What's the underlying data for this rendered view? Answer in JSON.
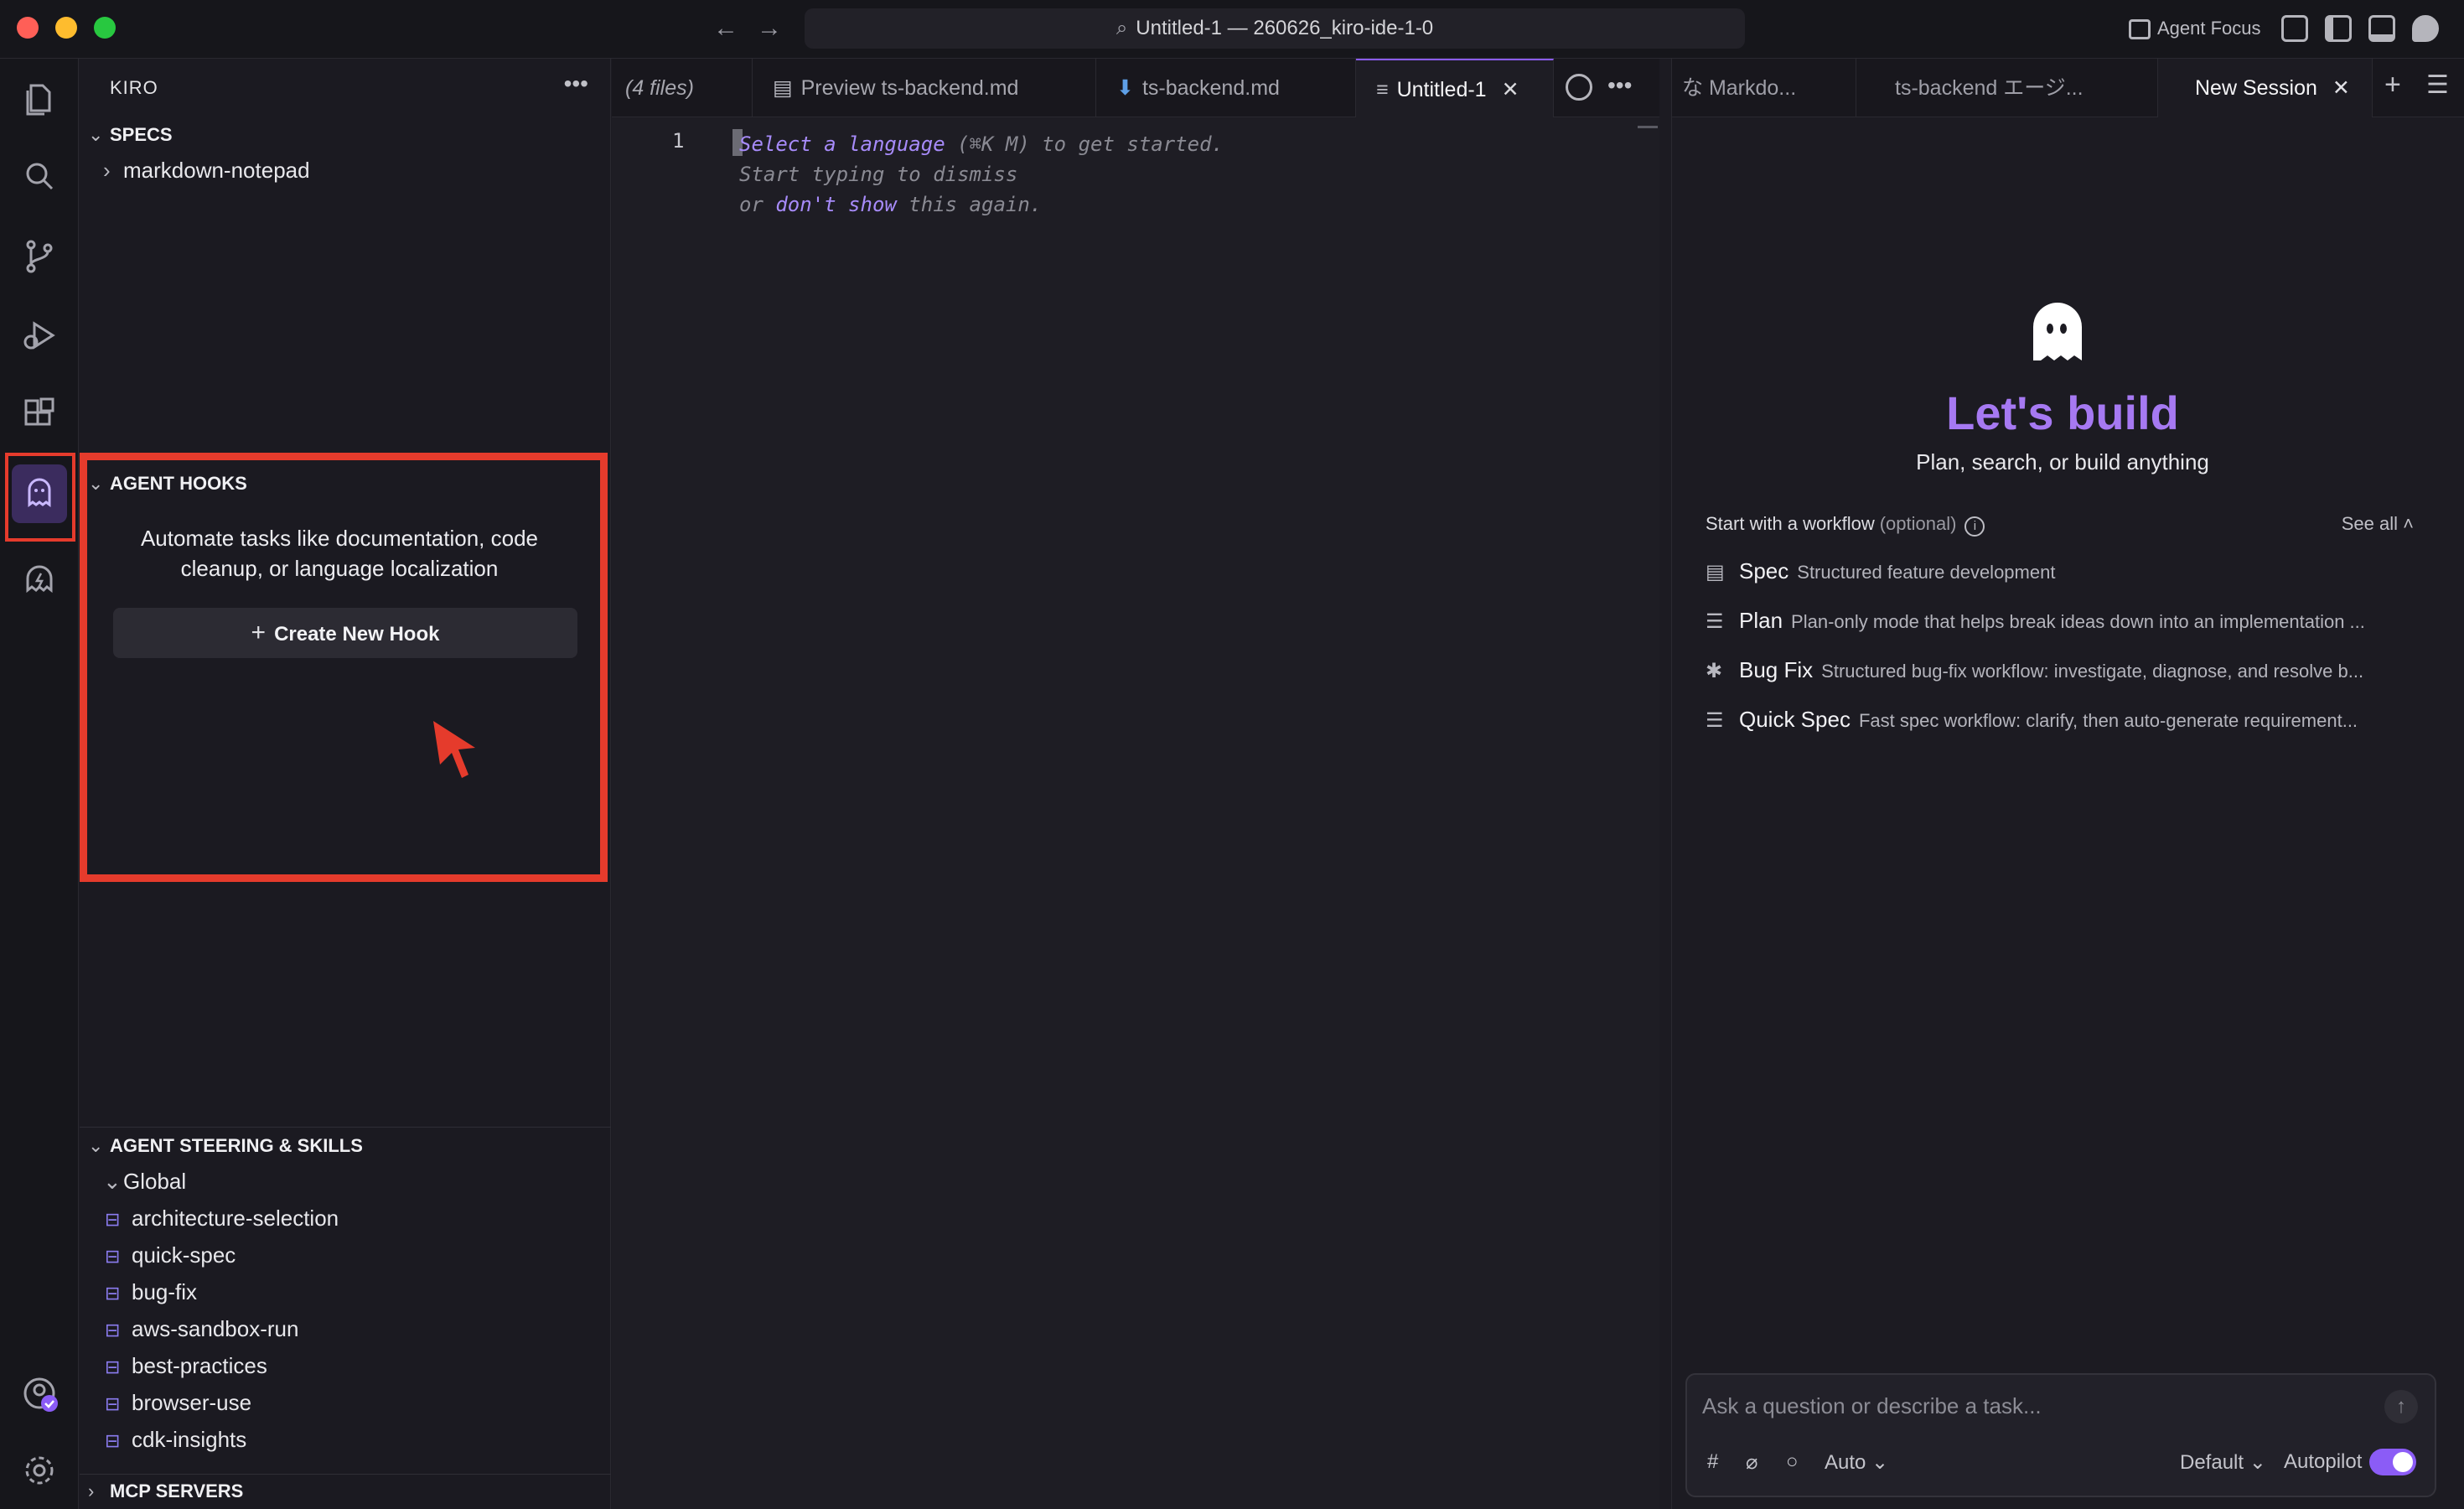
{
  "window": {
    "title": "Untitled-1 — 260626_kiro-ide-1-0",
    "agent_focus_label": "Agent Focus"
  },
  "sidebar": {
    "title": "KIRO",
    "specs": {
      "header": "SPECS",
      "items": [
        "markdown-notepad"
      ]
    },
    "agent_hooks": {
      "header": "AGENT HOOKS",
      "description": "Automate tasks like documentation, code cleanup, or language localization",
      "create_button": "Create New Hook"
    },
    "steering": {
      "header": "AGENT STEERING & SKILLS",
      "group": "Global",
      "items": [
        "architecture-selection",
        "quick-spec",
        "bug-fix",
        "aws-sandbox-run",
        "best-practices",
        "browser-use",
        "cdk-insights"
      ]
    },
    "mcp": {
      "header": "MCP SERVERS"
    }
  },
  "editor": {
    "tabs": [
      {
        "label": "(4 files)"
      },
      {
        "label": "Preview ts-backend.md"
      },
      {
        "label": "ts-backend.md"
      },
      {
        "label": "Untitled-1"
      }
    ],
    "line_number": "1",
    "hint": {
      "p1": "Select a language",
      "p2": " (⌘K M) to get started. Start typing to dismiss",
      "p3": "or ",
      "p4": "don't show",
      "p5": " this again."
    }
  },
  "chat": {
    "tabs": [
      {
        "label": "な Markdo..."
      },
      {
        "label": "ts-backend エージ..."
      },
      {
        "label": "New Session"
      }
    ],
    "heading": "Let's build",
    "subheading": "Plan, search, or build anything",
    "workflow_header": "Start with a workflow",
    "workflow_optional": "(optional)",
    "see_all": "See all",
    "workflows": [
      {
        "name": "Spec",
        "desc": "Structured feature development"
      },
      {
        "name": "Plan",
        "desc": "Plan-only mode that helps break ideas down into an implementation ..."
      },
      {
        "name": "Bug Fix",
        "desc": "Structured bug-fix workflow: investigate, diagnose, and resolve b..."
      },
      {
        "name": "Quick Spec",
        "desc": "Fast spec workflow: clarify, then auto-generate requirement..."
      }
    ],
    "input_placeholder": "Ask a question or describe a task...",
    "model": "Auto",
    "mode": "Default",
    "autopilot_label": "Autopilot",
    "autopilot_on": true
  },
  "colors": {
    "accent": "#a679f2",
    "highlight_box": "#e53b2c",
    "toggle": "#8b5cf6"
  }
}
